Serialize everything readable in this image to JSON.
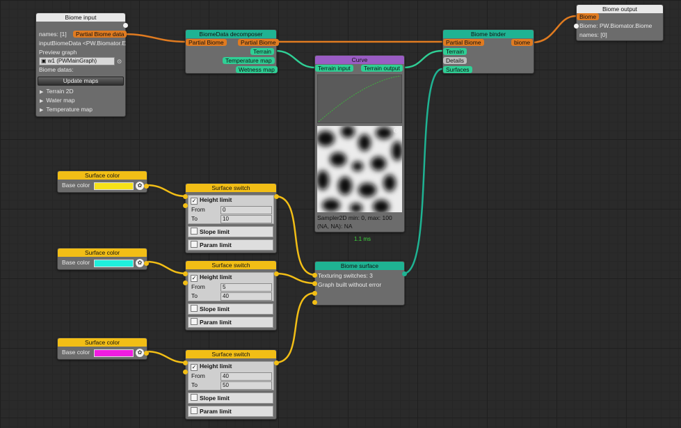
{
  "biome_input": {
    "title": "Biome input",
    "names_label": "names: [1]",
    "output_port": "Partial Biome data",
    "input_biome_data": "inputBiomeData <PW.Biomator.E",
    "preview_graph_label": "Preview graph",
    "preview_graph_value": "w1 (PWMainGraph)",
    "biome_datas_label": "Biome datas:",
    "update_button": "Update maps",
    "tree_items": [
      "Terrain 2D",
      "Water map",
      "Temperature map"
    ]
  },
  "decomposer": {
    "title": "BiomeData decomposer",
    "input_port": "Partial Biome",
    "outputs": [
      "Partial Biome",
      "Terrain",
      "Temperature map",
      "Wetness map"
    ]
  },
  "curve": {
    "title": "Curve",
    "input_port": "Terrain input",
    "output_port": "Terrain output",
    "sampler_text": "Sampler2D min: 0, max: 100",
    "na_text": "(NA, NA): NA",
    "timing": "1.1 ms"
  },
  "binder": {
    "title": "Biome binder",
    "inputs": [
      "Partial Biome",
      "Terrain",
      "Details",
      "Surfaces"
    ],
    "output_port": "biome"
  },
  "biome_output": {
    "title": "Biome output",
    "input_port": "Biome",
    "biome_text": "Biome: PW.Biomator.Biome",
    "names_text": "names: [0]"
  },
  "surface_colors": [
    {
      "title": "Surface color",
      "label": "Base color",
      "color": "#f7e21a"
    },
    {
      "title": "Surface color",
      "label": "Base color",
      "color": "#1ff0dc"
    },
    {
      "title": "Surface color",
      "label": "Base color",
      "color": "#f01ce0"
    }
  ],
  "surface_switches": [
    {
      "title": "Surface switch",
      "height_limit": "Height limit",
      "from_label": "From",
      "from": "0",
      "to_label": "To",
      "to": "10",
      "slope_limit": "Slope limit",
      "param_limit": "Param limit"
    },
    {
      "title": "Surface switch",
      "height_limit": "Height limit",
      "from_label": "From",
      "from": "5",
      "to_label": "To",
      "to": "40",
      "slope_limit": "Slope limit",
      "param_limit": "Param limit"
    },
    {
      "title": "Surface switch",
      "height_limit": "Height limit",
      "from_label": "From",
      "from": "40",
      "to_label": "To",
      "to": "50",
      "slope_limit": "Slope limit",
      "param_limit": "Param limit"
    }
  ],
  "biome_surface": {
    "title": "Biome surface",
    "texturing_switches": "Texturing switches: 3",
    "status": "Graph built without error"
  },
  "colors": {
    "wire_orange": "#e07b20",
    "wire_green": "#2fcf95",
    "wire_yellow": "#f2be16",
    "wire_teal": "#1fb393",
    "curve_line": "#3fb23f",
    "timing_green": "#3fd73f"
  }
}
